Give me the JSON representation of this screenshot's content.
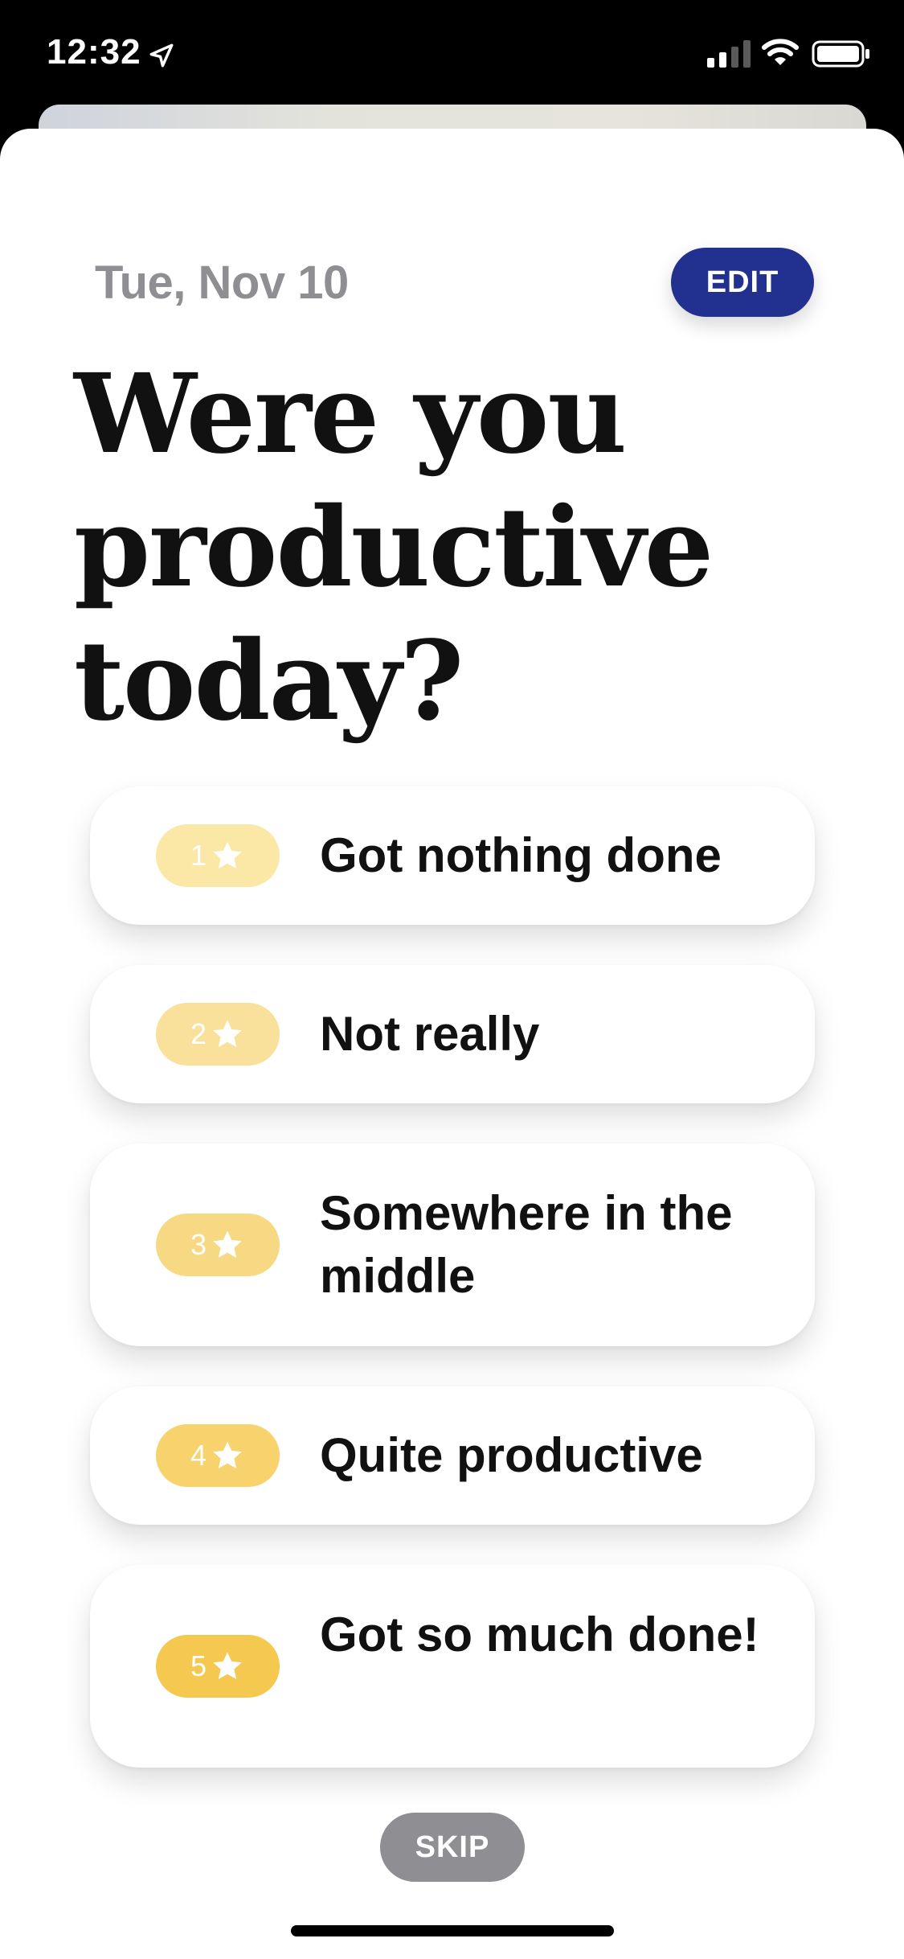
{
  "status_bar": {
    "time": "12:32",
    "icons": [
      "location-arrow-icon",
      "cellular-signal-icon",
      "wifi-icon",
      "battery-icon"
    ]
  },
  "header": {
    "date": "Tue, Nov 10",
    "edit_label": "EDIT",
    "accent_color": "#22308f"
  },
  "question": "Were you productive today?",
  "options": [
    {
      "rating": "1",
      "label": "Got nothing done",
      "pill_color": "#fbe7a6"
    },
    {
      "rating": "2",
      "label": "Not really",
      "pill_color": "#f9e19c"
    },
    {
      "rating": "3",
      "label": "Somewhere in the middle",
      "pill_color": "#f8d983"
    },
    {
      "rating": "4",
      "label": "Quite productive",
      "pill_color": "#f7d26d"
    },
    {
      "rating": "5",
      "label": "Got so much done!",
      "pill_color": "#f5c94f"
    }
  ],
  "skip_label": "SKIP"
}
